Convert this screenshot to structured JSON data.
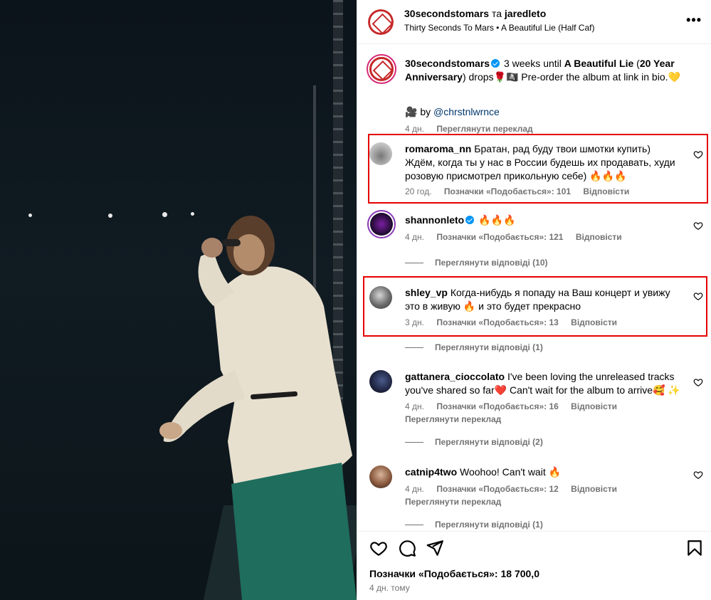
{
  "header": {
    "account": "30secondstomars",
    "connector": "та",
    "collab": "jaredleto",
    "audio": "Thirty Seconds To Mars",
    "separator": "•",
    "song": "A Beautiful Lie (Half Caf)",
    "more_icon": "more-horizontal-icon"
  },
  "caption": {
    "user": "30secondstomars",
    "text_a": "3 weeks until ",
    "bold_a": "A Beautiful Lie",
    "text_b": " (",
    "bold_b": "20 Year Anniversary",
    "text_c": ") drops",
    "text_d": " Pre-order the album at link in bio.",
    "credit_prefix": "by",
    "credit_user": "@chrstnlwrnce",
    "time": "4 дн.",
    "translate": "Переглянути переклад"
  },
  "comments": [
    {
      "user": "romaroma_nn",
      "text": "Братан, рад буду твои шмотки купить) Ждём, когда ты у нас в России будешь их продавать, худи розовую присмотрел прикольную себе) 🔥🔥🔥",
      "time": "20 год.",
      "likes": "Позначки «Подобається»: 101",
      "reply": "Відповісти"
    },
    {
      "user": "shannonleto",
      "text": "🔥🔥🔥",
      "time": "4 дн.",
      "likes": "Позначки «Подобається»: 121",
      "reply": "Відповісти",
      "replies": "Переглянути відповіді (10)"
    },
    {
      "user": "shley_vp",
      "text": "Когда-нибудь я попаду на Ваш концерт и увижу это в живую 🔥 и это будет прекрасно",
      "time": "3 дн.",
      "likes": "Позначки «Подобається»: 13",
      "reply": "Відповісти",
      "replies": "Переглянути відповіді (1)"
    },
    {
      "user": "gattanera_cioccolato",
      "text": "I've been loving the unreleased tracks you've shared so far❤️ Can't wait for the album to arrive🥰 ✨",
      "time": "4 дн.",
      "likes": "Позначки «Подобається»: 16",
      "reply": "Відповісти",
      "translate": "Переглянути переклад",
      "replies": "Переглянути відповіді (2)"
    },
    {
      "user": "catnip4two",
      "text": "Woohoo! Can't wait 🔥",
      "time": "4 дн.",
      "likes": "Позначки «Подобається»: 12",
      "reply": "Відповісти",
      "translate": "Переглянути переклад",
      "replies": "Переглянути відповіді (1)"
    }
  ],
  "footer": {
    "likes": "Позначки «Подобається»: 18 700,0",
    "time": "4 дн. тому"
  },
  "colors": {
    "highlight": "#e60000",
    "link": "#00376b",
    "verified": "#0095f6",
    "muted": "#737373"
  }
}
